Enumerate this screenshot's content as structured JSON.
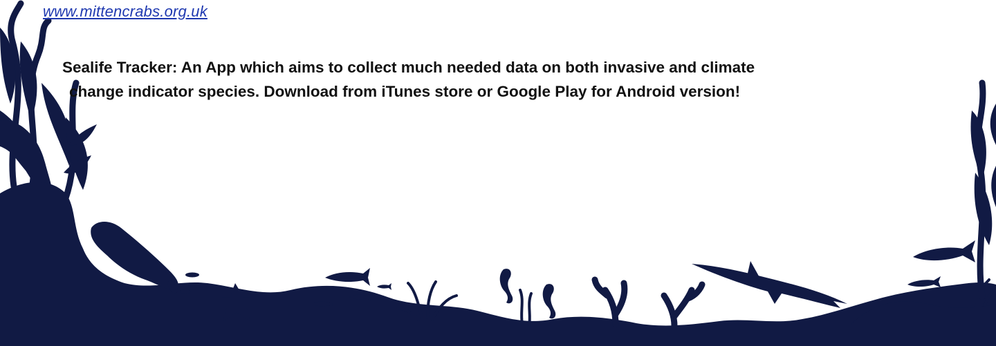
{
  "link": {
    "text": "www.mittencrabs.org.uk"
  },
  "description": {
    "line1": "Sealife Tracker: An App which aims to collect much needed data on both invasive and climate",
    "line2": "change indicator species. Download from iTunes store or Google Play for Android version!"
  },
  "illustration": {
    "color": "#111a44",
    "icons": [
      "seal-icon",
      "shark-icon",
      "seahorse-icon",
      "starfish-icon",
      "fish-icon",
      "seaweed-icon",
      "coral-icon"
    ]
  }
}
